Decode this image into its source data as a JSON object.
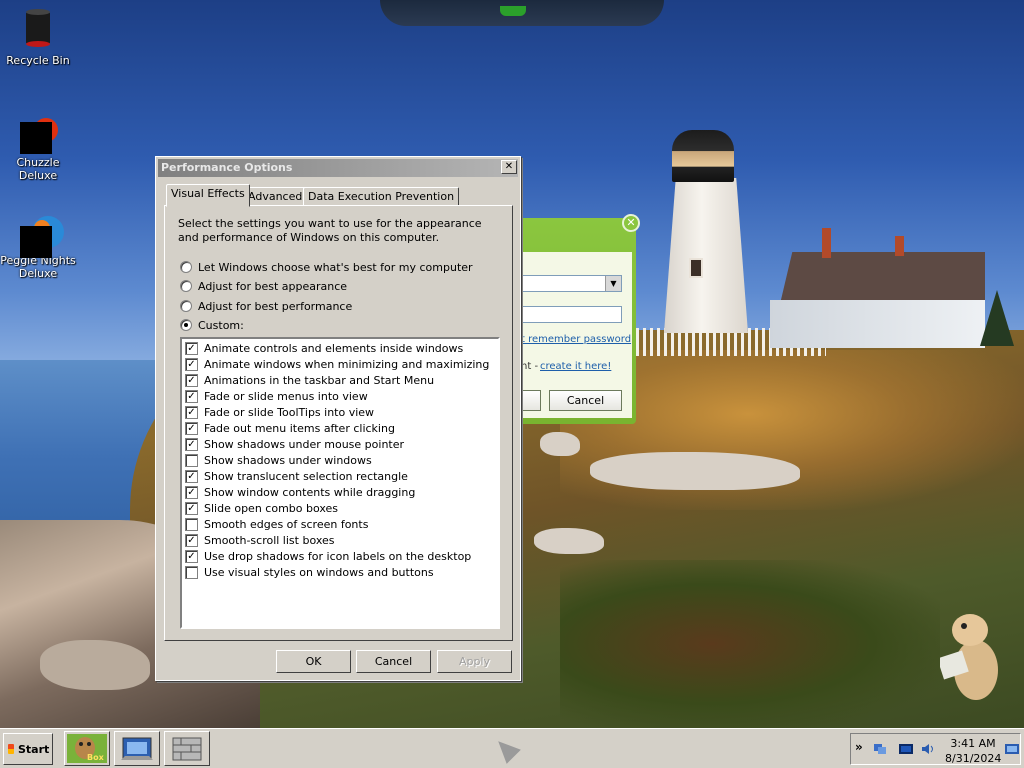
{
  "desktop": {
    "icons": [
      {
        "label": "Recycle Bin"
      },
      {
        "label": "Chuzzle Deluxe"
      },
      {
        "label": "Peggle Nights Deluxe"
      }
    ]
  },
  "background_window": {
    "link_remember": "t remember password",
    "account_text": "nt -",
    "link_create": "create it here!",
    "cancel_label": "Cancel"
  },
  "dialog": {
    "title": "Performance Options",
    "close_glyph": "✕",
    "tabs": [
      {
        "label": "Visual Effects",
        "active": true
      },
      {
        "label": "Advanced",
        "active": false
      },
      {
        "label": "Data Execution Prevention",
        "active": false
      }
    ],
    "intro": "Select the settings you want to use for the appearance and performance of Windows on this computer.",
    "options": [
      {
        "label": "Let Windows choose what's best for my computer",
        "selected": false
      },
      {
        "label": "Adjust for best appearance",
        "selected": false
      },
      {
        "label": "Adjust for best performance",
        "selected": false
      },
      {
        "label": "Custom:",
        "selected": true
      }
    ],
    "effects": [
      {
        "label": "Animate controls and elements inside windows",
        "checked": true
      },
      {
        "label": "Animate windows when minimizing and maximizing",
        "checked": true
      },
      {
        "label": "Animations in the taskbar and Start Menu",
        "checked": true
      },
      {
        "label": "Fade or slide menus into view",
        "checked": true
      },
      {
        "label": "Fade or slide ToolTips into view",
        "checked": true
      },
      {
        "label": "Fade out menu items after clicking",
        "checked": true
      },
      {
        "label": "Show shadows under mouse pointer",
        "checked": true
      },
      {
        "label": "Show shadows under windows",
        "checked": false
      },
      {
        "label": "Show translucent selection rectangle",
        "checked": true
      },
      {
        "label": "Show window contents while dragging",
        "checked": true
      },
      {
        "label": "Slide open combo boxes",
        "checked": true
      },
      {
        "label": "Smooth edges of screen fonts",
        "checked": false
      },
      {
        "label": "Smooth-scroll list boxes",
        "checked": true
      },
      {
        "label": "Use drop shadows for icon labels on the desktop",
        "checked": true
      },
      {
        "label": "Use visual styles on windows and buttons",
        "checked": false
      }
    ],
    "buttons": {
      "ok": "OK",
      "cancel": "Cancel",
      "apply": "Apply"
    }
  },
  "taskbar": {
    "start_label": "Start",
    "quick_launch": [
      {
        "icon": "gamehouse-box-icon",
        "label": "Box"
      },
      {
        "icon": "show-desktop-icon"
      },
      {
        "icon": "firewall-icon"
      }
    ],
    "tray": {
      "expand_glyph": "»",
      "icons": [
        "network-icon",
        "display-icon",
        "volume-icon",
        "monitor-icon"
      ],
      "time": "3:41 AM",
      "date": "8/31/2024"
    }
  },
  "colors": {
    "dialog_face": "#d4d0c8",
    "titlebar_inactive": "#808080",
    "bg_window_green": "#8bc63f",
    "link_blue": "#1e5faa"
  }
}
